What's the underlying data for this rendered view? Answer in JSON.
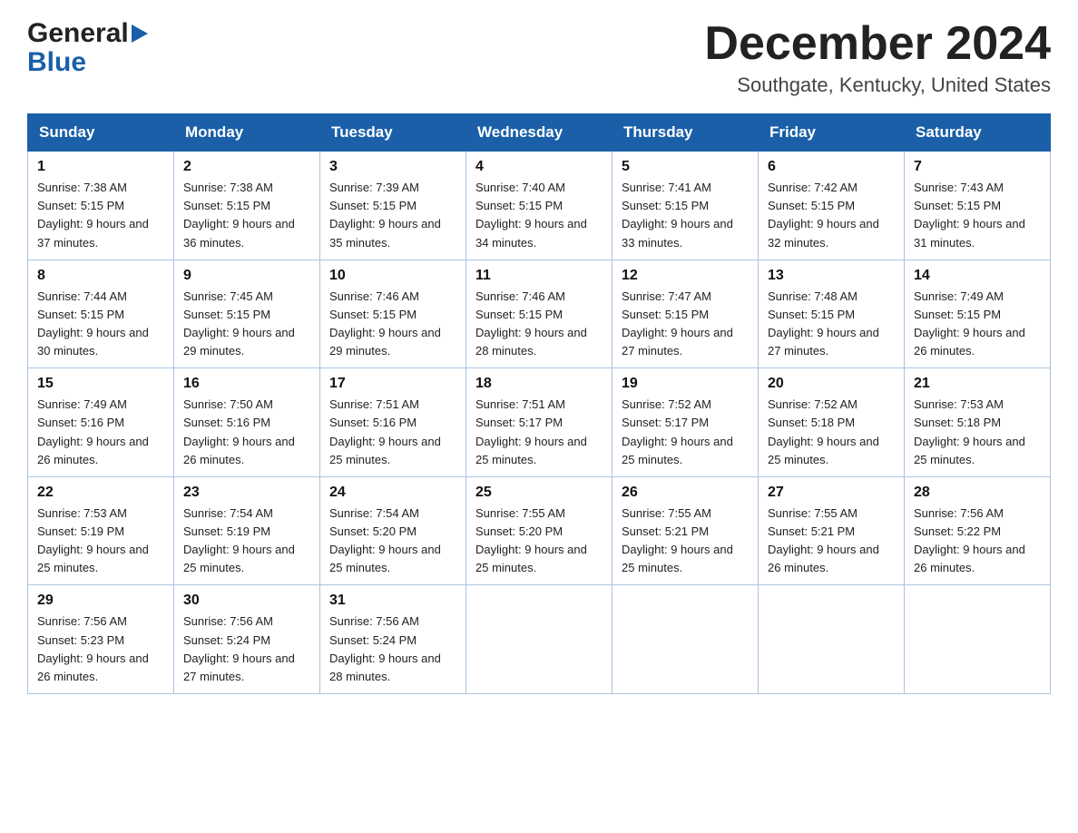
{
  "header": {
    "logo_line1": "General",
    "logo_line2": "Blue",
    "month": "December 2024",
    "location": "Southgate, Kentucky, United States"
  },
  "days_of_week": [
    "Sunday",
    "Monday",
    "Tuesday",
    "Wednesday",
    "Thursday",
    "Friday",
    "Saturday"
  ],
  "weeks": [
    [
      {
        "day": "1",
        "sunrise": "7:38 AM",
        "sunset": "5:15 PM",
        "daylight": "9 hours and 37 minutes."
      },
      {
        "day": "2",
        "sunrise": "7:38 AM",
        "sunset": "5:15 PM",
        "daylight": "9 hours and 36 minutes."
      },
      {
        "day": "3",
        "sunrise": "7:39 AM",
        "sunset": "5:15 PM",
        "daylight": "9 hours and 35 minutes."
      },
      {
        "day": "4",
        "sunrise": "7:40 AM",
        "sunset": "5:15 PM",
        "daylight": "9 hours and 34 minutes."
      },
      {
        "day": "5",
        "sunrise": "7:41 AM",
        "sunset": "5:15 PM",
        "daylight": "9 hours and 33 minutes."
      },
      {
        "day": "6",
        "sunrise": "7:42 AM",
        "sunset": "5:15 PM",
        "daylight": "9 hours and 32 minutes."
      },
      {
        "day": "7",
        "sunrise": "7:43 AM",
        "sunset": "5:15 PM",
        "daylight": "9 hours and 31 minutes."
      }
    ],
    [
      {
        "day": "8",
        "sunrise": "7:44 AM",
        "sunset": "5:15 PM",
        "daylight": "9 hours and 30 minutes."
      },
      {
        "day": "9",
        "sunrise": "7:45 AM",
        "sunset": "5:15 PM",
        "daylight": "9 hours and 29 minutes."
      },
      {
        "day": "10",
        "sunrise": "7:46 AM",
        "sunset": "5:15 PM",
        "daylight": "9 hours and 29 minutes."
      },
      {
        "day": "11",
        "sunrise": "7:46 AM",
        "sunset": "5:15 PM",
        "daylight": "9 hours and 28 minutes."
      },
      {
        "day": "12",
        "sunrise": "7:47 AM",
        "sunset": "5:15 PM",
        "daylight": "9 hours and 27 minutes."
      },
      {
        "day": "13",
        "sunrise": "7:48 AM",
        "sunset": "5:15 PM",
        "daylight": "9 hours and 27 minutes."
      },
      {
        "day": "14",
        "sunrise": "7:49 AM",
        "sunset": "5:15 PM",
        "daylight": "9 hours and 26 minutes."
      }
    ],
    [
      {
        "day": "15",
        "sunrise": "7:49 AM",
        "sunset": "5:16 PM",
        "daylight": "9 hours and 26 minutes."
      },
      {
        "day": "16",
        "sunrise": "7:50 AM",
        "sunset": "5:16 PM",
        "daylight": "9 hours and 26 minutes."
      },
      {
        "day": "17",
        "sunrise": "7:51 AM",
        "sunset": "5:16 PM",
        "daylight": "9 hours and 25 minutes."
      },
      {
        "day": "18",
        "sunrise": "7:51 AM",
        "sunset": "5:17 PM",
        "daylight": "9 hours and 25 minutes."
      },
      {
        "day": "19",
        "sunrise": "7:52 AM",
        "sunset": "5:17 PM",
        "daylight": "9 hours and 25 minutes."
      },
      {
        "day": "20",
        "sunrise": "7:52 AM",
        "sunset": "5:18 PM",
        "daylight": "9 hours and 25 minutes."
      },
      {
        "day": "21",
        "sunrise": "7:53 AM",
        "sunset": "5:18 PM",
        "daylight": "9 hours and 25 minutes."
      }
    ],
    [
      {
        "day": "22",
        "sunrise": "7:53 AM",
        "sunset": "5:19 PM",
        "daylight": "9 hours and 25 minutes."
      },
      {
        "day": "23",
        "sunrise": "7:54 AM",
        "sunset": "5:19 PM",
        "daylight": "9 hours and 25 minutes."
      },
      {
        "day": "24",
        "sunrise": "7:54 AM",
        "sunset": "5:20 PM",
        "daylight": "9 hours and 25 minutes."
      },
      {
        "day": "25",
        "sunrise": "7:55 AM",
        "sunset": "5:20 PM",
        "daylight": "9 hours and 25 minutes."
      },
      {
        "day": "26",
        "sunrise": "7:55 AM",
        "sunset": "5:21 PM",
        "daylight": "9 hours and 25 minutes."
      },
      {
        "day": "27",
        "sunrise": "7:55 AM",
        "sunset": "5:21 PM",
        "daylight": "9 hours and 26 minutes."
      },
      {
        "day": "28",
        "sunrise": "7:56 AM",
        "sunset": "5:22 PM",
        "daylight": "9 hours and 26 minutes."
      }
    ],
    [
      {
        "day": "29",
        "sunrise": "7:56 AM",
        "sunset": "5:23 PM",
        "daylight": "9 hours and 26 minutes."
      },
      {
        "day": "30",
        "sunrise": "7:56 AM",
        "sunset": "5:24 PM",
        "daylight": "9 hours and 27 minutes."
      },
      {
        "day": "31",
        "sunrise": "7:56 AM",
        "sunset": "5:24 PM",
        "daylight": "9 hours and 28 minutes."
      },
      null,
      null,
      null,
      null
    ]
  ]
}
